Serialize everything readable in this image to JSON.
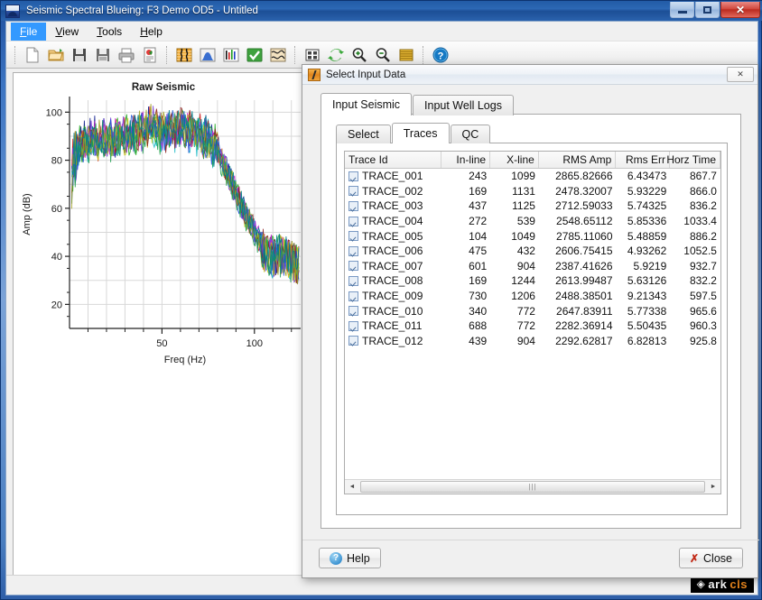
{
  "window": {
    "title": "Seismic Spectral Blueing: F3 Demo OD5 - Untitled",
    "buttons": {
      "minimize": "",
      "maximize": "",
      "close": "✕"
    }
  },
  "menu": [
    {
      "label": "File",
      "mnemonic": "F",
      "active": true
    },
    {
      "label": "View",
      "mnemonic": "V",
      "active": false
    },
    {
      "label": "Tools",
      "mnemonic": "T",
      "active": false
    },
    {
      "label": "Help",
      "mnemonic": "H",
      "active": false
    }
  ],
  "toolbar": {
    "groups": [
      [
        "new-document-icon",
        "open-folder-icon",
        "save-icon",
        "save-all-icon",
        "print-icon",
        "report-icon"
      ],
      [
        "seismic-trace-icon",
        "spectrum-curve-icon",
        "color-bars-icon",
        "green-check-icon",
        "wavelet-icon"
      ],
      [
        "grid-layout-icon",
        "refresh-icon",
        "zoom-in-icon",
        "zoom-out-icon",
        "colorbar-icon",
        "help-info-icon"
      ]
    ]
  },
  "chart_data": {
    "type": "line",
    "title": "Raw Seismic",
    "xlabel": "Freq (Hz)",
    "ylabel": "Amp (dB)",
    "xlim": [
      0,
      125
    ],
    "ylim": [
      10,
      105
    ],
    "xticks": [
      50,
      100
    ],
    "xtick_labels": [
      "50",
      "100"
    ],
    "yticks": [
      20,
      40,
      60,
      80,
      100
    ],
    "ytick_labels": [
      "20",
      "40",
      "60",
      "80",
      "100"
    ],
    "x_minor_step": 10,
    "y_minor_step": 10,
    "grid": true,
    "legend": "none",
    "series_count": 12,
    "series_colors": [
      "#0c1a8c",
      "#d11f1f",
      "#1fa61f",
      "#18b9c4",
      "#d61fd6",
      "#c8c81a",
      "#7a3fd6",
      "#8c2020",
      "#2255d6",
      "#20a050",
      "#a0a020",
      "#00808a"
    ],
    "description": "Overlay of 12 noisy seismic amplitude spectra in dB versus frequency; broad plateau near 85-100 dB between roughly 5 and 80 Hz, steep roll-off from 80 to 105 Hz, and a noise floor around 30-45 dB above 105 Hz.",
    "envelope_x": [
      0,
      2,
      5,
      8,
      12,
      16,
      20,
      25,
      30,
      35,
      40,
      45,
      50,
      55,
      60,
      65,
      70,
      75,
      80,
      85,
      90,
      95,
      100,
      105,
      110,
      115,
      120,
      125
    ],
    "envelope_mean": [
      55,
      78,
      85,
      87,
      88,
      88,
      88,
      89,
      90,
      90,
      93,
      94,
      91,
      92,
      93,
      92,
      90,
      88,
      84,
      75,
      66,
      57,
      50,
      42,
      39,
      40,
      38,
      34
    ]
  },
  "dialog": {
    "title": "Select Input Data",
    "close_glyph": "✕",
    "outer_tabs": [
      {
        "label": "Input Seismic",
        "selected": true
      },
      {
        "label": "Input Well Logs",
        "selected": false
      }
    ],
    "inner_tabs": [
      {
        "label": "Select",
        "selected": false
      },
      {
        "label": "Traces",
        "selected": true
      },
      {
        "label": "QC",
        "selected": false
      }
    ],
    "table": {
      "columns": [
        "Trace Id",
        "In-line",
        "X-line",
        "RMS Amp",
        "Rms Err",
        "Horz Time"
      ],
      "rows": [
        {
          "checked": true,
          "id": "TRACE_001",
          "inline": "243",
          "xline": "1099",
          "rms_amp": "2865.82666",
          "rms_err": "6.43473",
          "horz_time": "867.7"
        },
        {
          "checked": true,
          "id": "TRACE_002",
          "inline": "169",
          "xline": "1131",
          "rms_amp": "2478.32007",
          "rms_err": "5.93229",
          "horz_time": "866.0"
        },
        {
          "checked": true,
          "id": "TRACE_003",
          "inline": "437",
          "xline": "1125",
          "rms_amp": "2712.59033",
          "rms_err": "5.74325",
          "horz_time": "836.2"
        },
        {
          "checked": true,
          "id": "TRACE_004",
          "inline": "272",
          "xline": "539",
          "rms_amp": "2548.65112",
          "rms_err": "5.85336",
          "horz_time": "1033.4"
        },
        {
          "checked": true,
          "id": "TRACE_005",
          "inline": "104",
          "xline": "1049",
          "rms_amp": "2785.11060",
          "rms_err": "5.48859",
          "horz_time": "886.2"
        },
        {
          "checked": true,
          "id": "TRACE_006",
          "inline": "475",
          "xline": "432",
          "rms_amp": "2606.75415",
          "rms_err": "4.93262",
          "horz_time": "1052.5"
        },
        {
          "checked": true,
          "id": "TRACE_007",
          "inline": "601",
          "xline": "904",
          "rms_amp": "2387.41626",
          "rms_err": "5.9219",
          "horz_time": "932.7"
        },
        {
          "checked": true,
          "id": "TRACE_008",
          "inline": "169",
          "xline": "1244",
          "rms_amp": "2613.99487",
          "rms_err": "5.63126",
          "horz_time": "832.2"
        },
        {
          "checked": true,
          "id": "TRACE_009",
          "inline": "730",
          "xline": "1206",
          "rms_amp": "2488.38501",
          "rms_err": "9.21343",
          "horz_time": "597.5"
        },
        {
          "checked": true,
          "id": "TRACE_010",
          "inline": "340",
          "xline": "772",
          "rms_amp": "2647.83911",
          "rms_err": "5.77338",
          "horz_time": "965.6"
        },
        {
          "checked": true,
          "id": "TRACE_011",
          "inline": "688",
          "xline": "772",
          "rms_amp": "2282.36914",
          "rms_err": "5.50435",
          "horz_time": "960.3"
        },
        {
          "checked": true,
          "id": "TRACE_012",
          "inline": "439",
          "xline": "904",
          "rms_amp": "2292.62817",
          "rms_err": "6.82813",
          "horz_time": "925.8"
        }
      ]
    },
    "scrollbar": {
      "left_arrow": "◄",
      "right_arrow": "►",
      "grip": "|||"
    },
    "footer": {
      "help_label": "Help",
      "help_glyph": "?",
      "close_label": "Close",
      "close_glyph": "✗"
    }
  },
  "status": {
    "logo_diamond": "◈",
    "logo_ark": "ark",
    "logo_cls": "cls"
  }
}
